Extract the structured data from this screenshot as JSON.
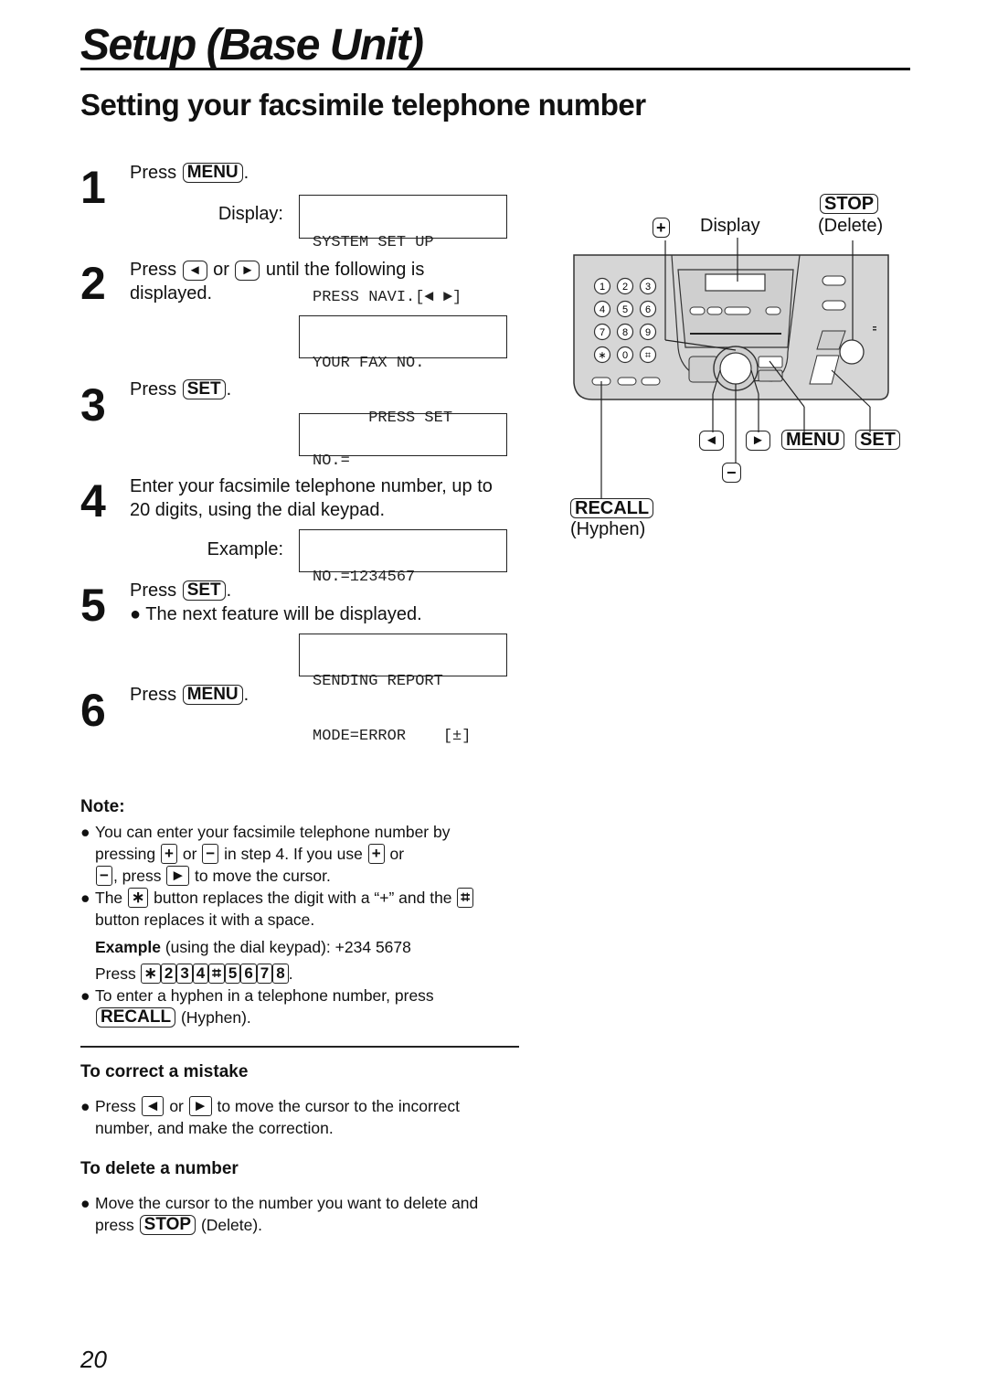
{
  "header": {
    "title": "Setup (Base Unit)"
  },
  "section": {
    "title": "Setting your facsimile telephone number"
  },
  "steps": [
    {
      "num": "1",
      "press": "Press",
      "key": "MENU",
      "end": ".",
      "display_label": "Display:",
      "lcd": [
        "SYSTEM SET UP",
        "PRESS NAVI.[◄ ►]"
      ]
    },
    {
      "num": "2",
      "press": "Press",
      "key_left": "◄",
      "or": "or",
      "key_right": "►",
      "rest": "until the following is",
      "rest2": "displayed.",
      "lcd": [
        "YOUR FAX NO.",
        "      PRESS SET"
      ]
    },
    {
      "num": "3",
      "press": "Press",
      "key": "SET",
      "end": ".",
      "lcd": [
        "NO.=",
        ""
      ]
    },
    {
      "num": "4",
      "line1": "Enter your facsimile telephone number, up to",
      "line2": "20 digits, using the dial keypad.",
      "example_label": "Example:",
      "lcd": [
        "NO.=1234567",
        ""
      ]
    },
    {
      "num": "5",
      "press": "Press",
      "key": "SET",
      "end": ".",
      "bullet": "The next feature will be displayed.",
      "lcd": [
        "SENDING REPORT",
        "MODE=ERROR    [±]"
      ]
    },
    {
      "num": "6",
      "press": "Press",
      "key": "MENU",
      "end": "."
    }
  ],
  "diagram": {
    "plus_key": "+",
    "display_label": "Display",
    "stop_key": "STOP",
    "stop_caption": "(Delete)",
    "left_key": "◄",
    "right_key": "►",
    "menu_key": "MENU",
    "set_key": "SET",
    "minus_key": "−",
    "recall_key": "RECALL",
    "recall_caption": "(Hyphen)",
    "keypad": [
      "1",
      "2",
      "3",
      "4",
      "5",
      "6",
      "7",
      "8",
      "9",
      "∗",
      "0",
      "⌗"
    ]
  },
  "note": {
    "title": "Note:",
    "b1": {
      "t1": "You can enter your facsimile telephone number by",
      "t2": "pressing",
      "k1": "+",
      "or1": "or",
      "k2": "−",
      "t3": "in step 4. If you use",
      "k3": "+",
      "or2": "or",
      "k4": "−",
      "t4": ", press",
      "k5": "►",
      "t5": "to move the cursor."
    },
    "b2": {
      "t1": "The",
      "k1": "∗",
      "t2": "button replaces the digit with a “+” and the",
      "k2": "⌗",
      "t3": "button replaces it with a space."
    },
    "example": {
      "bold": "Example",
      "rest": "(using the dial keypad):  +234  5678",
      "press": "Press",
      "keys": [
        "∗",
        "2",
        "3",
        "4",
        "⌗",
        "5",
        "6",
        "7",
        "8"
      ],
      "end": "."
    },
    "b3": {
      "t1": "To enter a hyphen in a telephone number, press",
      "k1": "RECALL",
      "t2": "(Hyphen)."
    }
  },
  "correct": {
    "title": "To correct a mistake",
    "press": "Press",
    "k1": "◄",
    "or": "or",
    "k2": "►",
    "t1": "to move the cursor to the incorrect",
    "t2": "number, and make the correction."
  },
  "delete": {
    "title": "To delete a number",
    "t1": "Move the cursor to the number you want to delete and",
    "press": "press",
    "k1": "STOP",
    "t2": "(Delete)."
  },
  "page_number": "20"
}
